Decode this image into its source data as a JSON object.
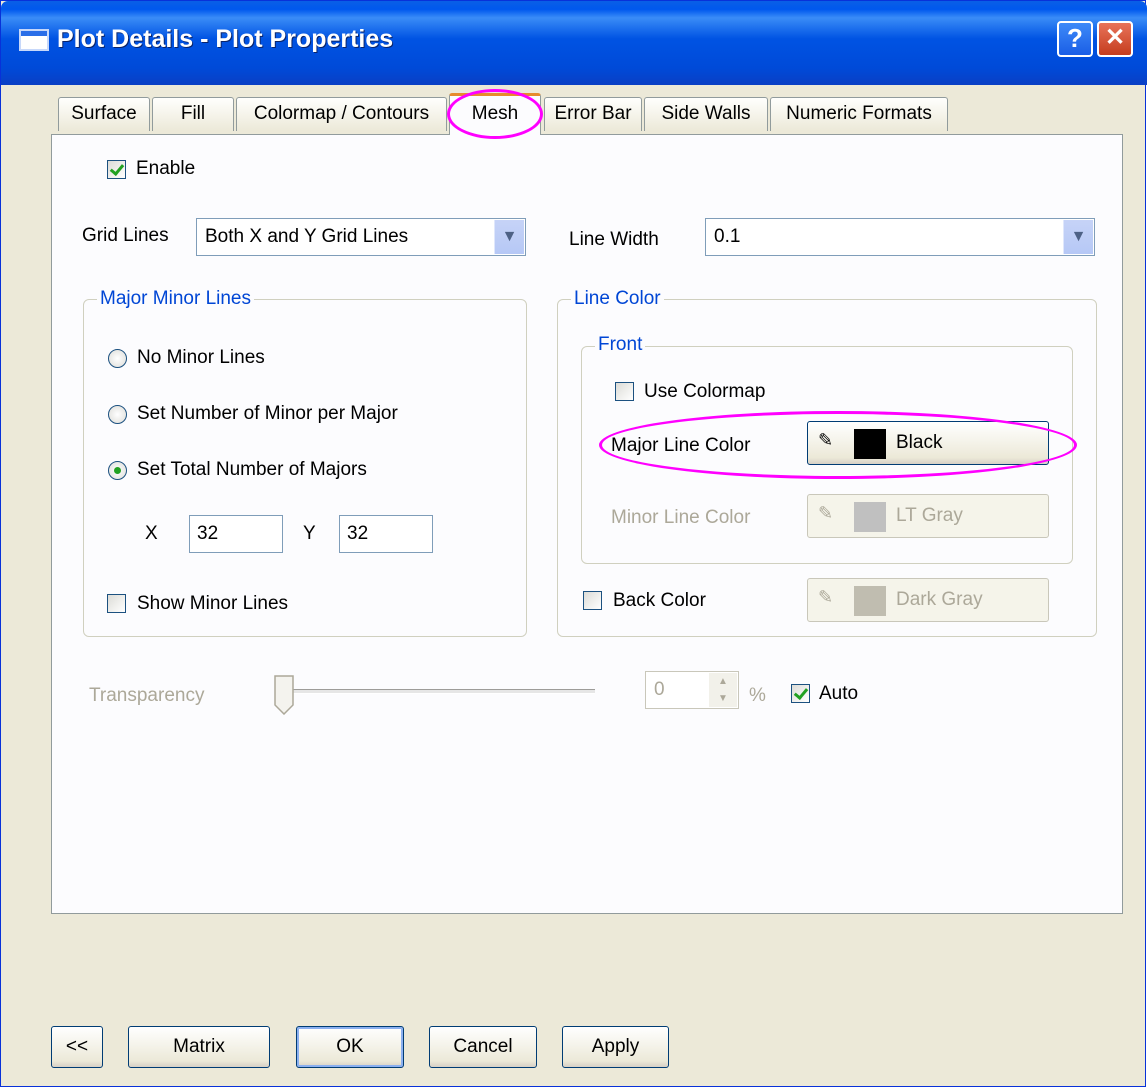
{
  "window": {
    "title": "Plot Details - Plot Properties",
    "help_label": "?",
    "close_label": "✕"
  },
  "tabs": [
    {
      "label": "Surface"
    },
    {
      "label": "Fill"
    },
    {
      "label": "Colormap / Contours"
    },
    {
      "label": "Mesh",
      "active": true
    },
    {
      "label": "Error Bar"
    },
    {
      "label": "Side Walls"
    },
    {
      "label": "Numeric Formats"
    }
  ],
  "mesh": {
    "enable": {
      "label": "Enable",
      "checked": true
    },
    "grid_lines": {
      "label": "Grid Lines",
      "value": "Both X and Y Grid Lines"
    },
    "line_width": {
      "label": "Line Width",
      "value": "0.1"
    },
    "major_minor": {
      "title": "Major Minor Lines",
      "opt_no_minor": "No Minor Lines",
      "opt_set_minor": "Set Number of Minor per Major",
      "opt_total_majors": "Set Total Number of Majors",
      "selected": "total_majors",
      "x_label": "X",
      "x_value": "32",
      "y_label": "Y",
      "y_value": "32",
      "show_minor": {
        "label": "Show Minor Lines",
        "checked": false
      }
    },
    "line_color": {
      "title": "Line Color",
      "front_title": "Front",
      "use_colormap": {
        "label": "Use Colormap",
        "checked": false
      },
      "major": {
        "label": "Major Line Color",
        "color_name": "Black",
        "swatch": "#000000"
      },
      "minor": {
        "label": "Minor Line Color",
        "color_name": "LT Gray",
        "swatch": "#c0c0c0"
      },
      "back": {
        "label": "Back Color",
        "color_name": "Dark Gray",
        "swatch": "#c0bdb0",
        "checked": false
      }
    },
    "transparency": {
      "label": "Transparency",
      "value": "0",
      "unit": "%",
      "auto_label": "Auto",
      "auto_checked": true
    }
  },
  "buttons": {
    "collapse": "<<",
    "matrix": "Matrix",
    "ok": "OK",
    "cancel": "Cancel",
    "apply": "Apply"
  },
  "colors": {
    "highlight": "#ff00ff",
    "title_bar": "#0054e3",
    "group_title": "#0046d5"
  }
}
